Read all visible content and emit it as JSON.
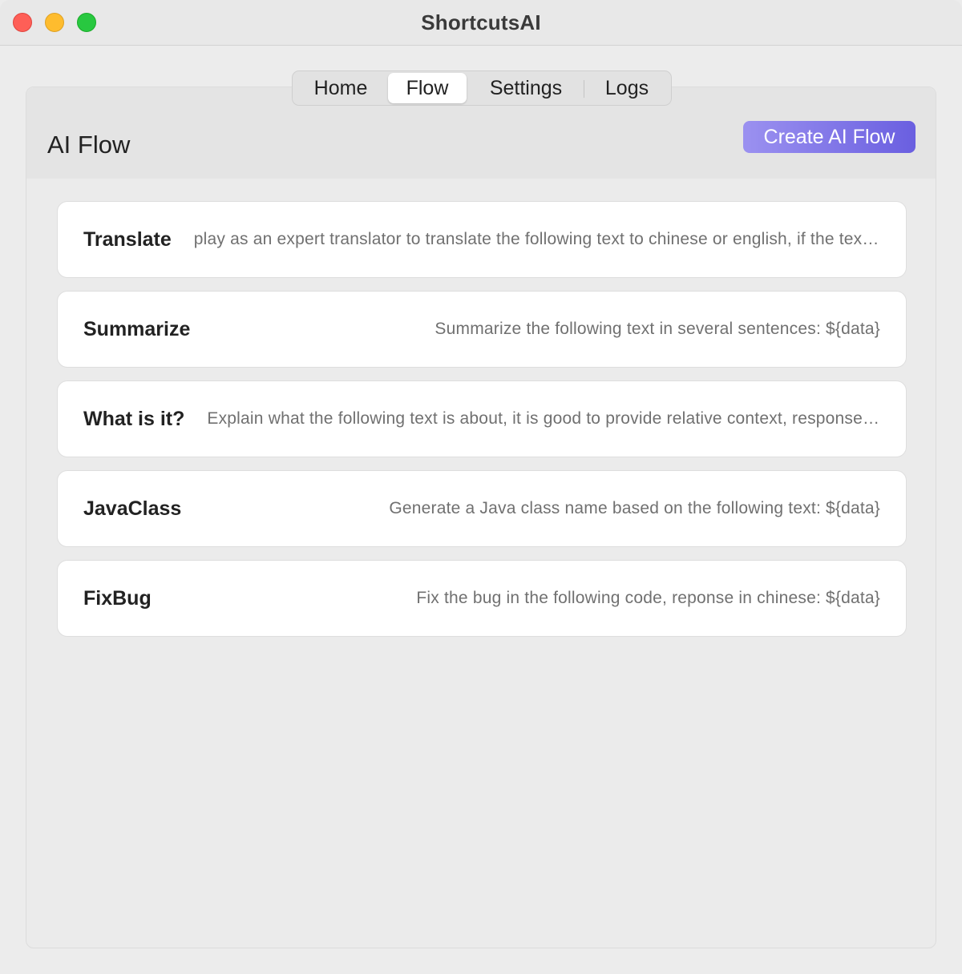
{
  "window": {
    "title": "ShortcutsAI"
  },
  "tabs": [
    {
      "label": "Home",
      "active": false
    },
    {
      "label": "Flow",
      "active": true
    },
    {
      "label": "Settings",
      "active": false
    },
    {
      "label": "Logs",
      "active": false
    }
  ],
  "page": {
    "title": "AI Flow",
    "create_button": "Create AI Flow"
  },
  "flows": [
    {
      "name": "Translate",
      "prompt": "play as an expert translator to translate the following text to chinese or english, if the text is chinese, translate to english: ${data}"
    },
    {
      "name": "Summarize",
      "prompt": "Summarize the following text in several sentences: ${data}"
    },
    {
      "name": "What is it?",
      "prompt": "Explain what the following text is about, it is good to provide relative context, response in chinese: ${data}"
    },
    {
      "name": "JavaClass",
      "prompt": "Generate a Java class name based on the following text: ${data}"
    },
    {
      "name": "FixBug",
      "prompt": "Fix the bug in the following code, reponse in chinese: ${data}"
    }
  ],
  "colors": {
    "accent_start": "#9b91f0",
    "accent_end": "#6a5fe0",
    "close": "#fe5f57",
    "minimize": "#febc2e",
    "maximize": "#28c840"
  },
  "icons": [
    "close-icon",
    "minimize-icon",
    "maximize-icon"
  ]
}
